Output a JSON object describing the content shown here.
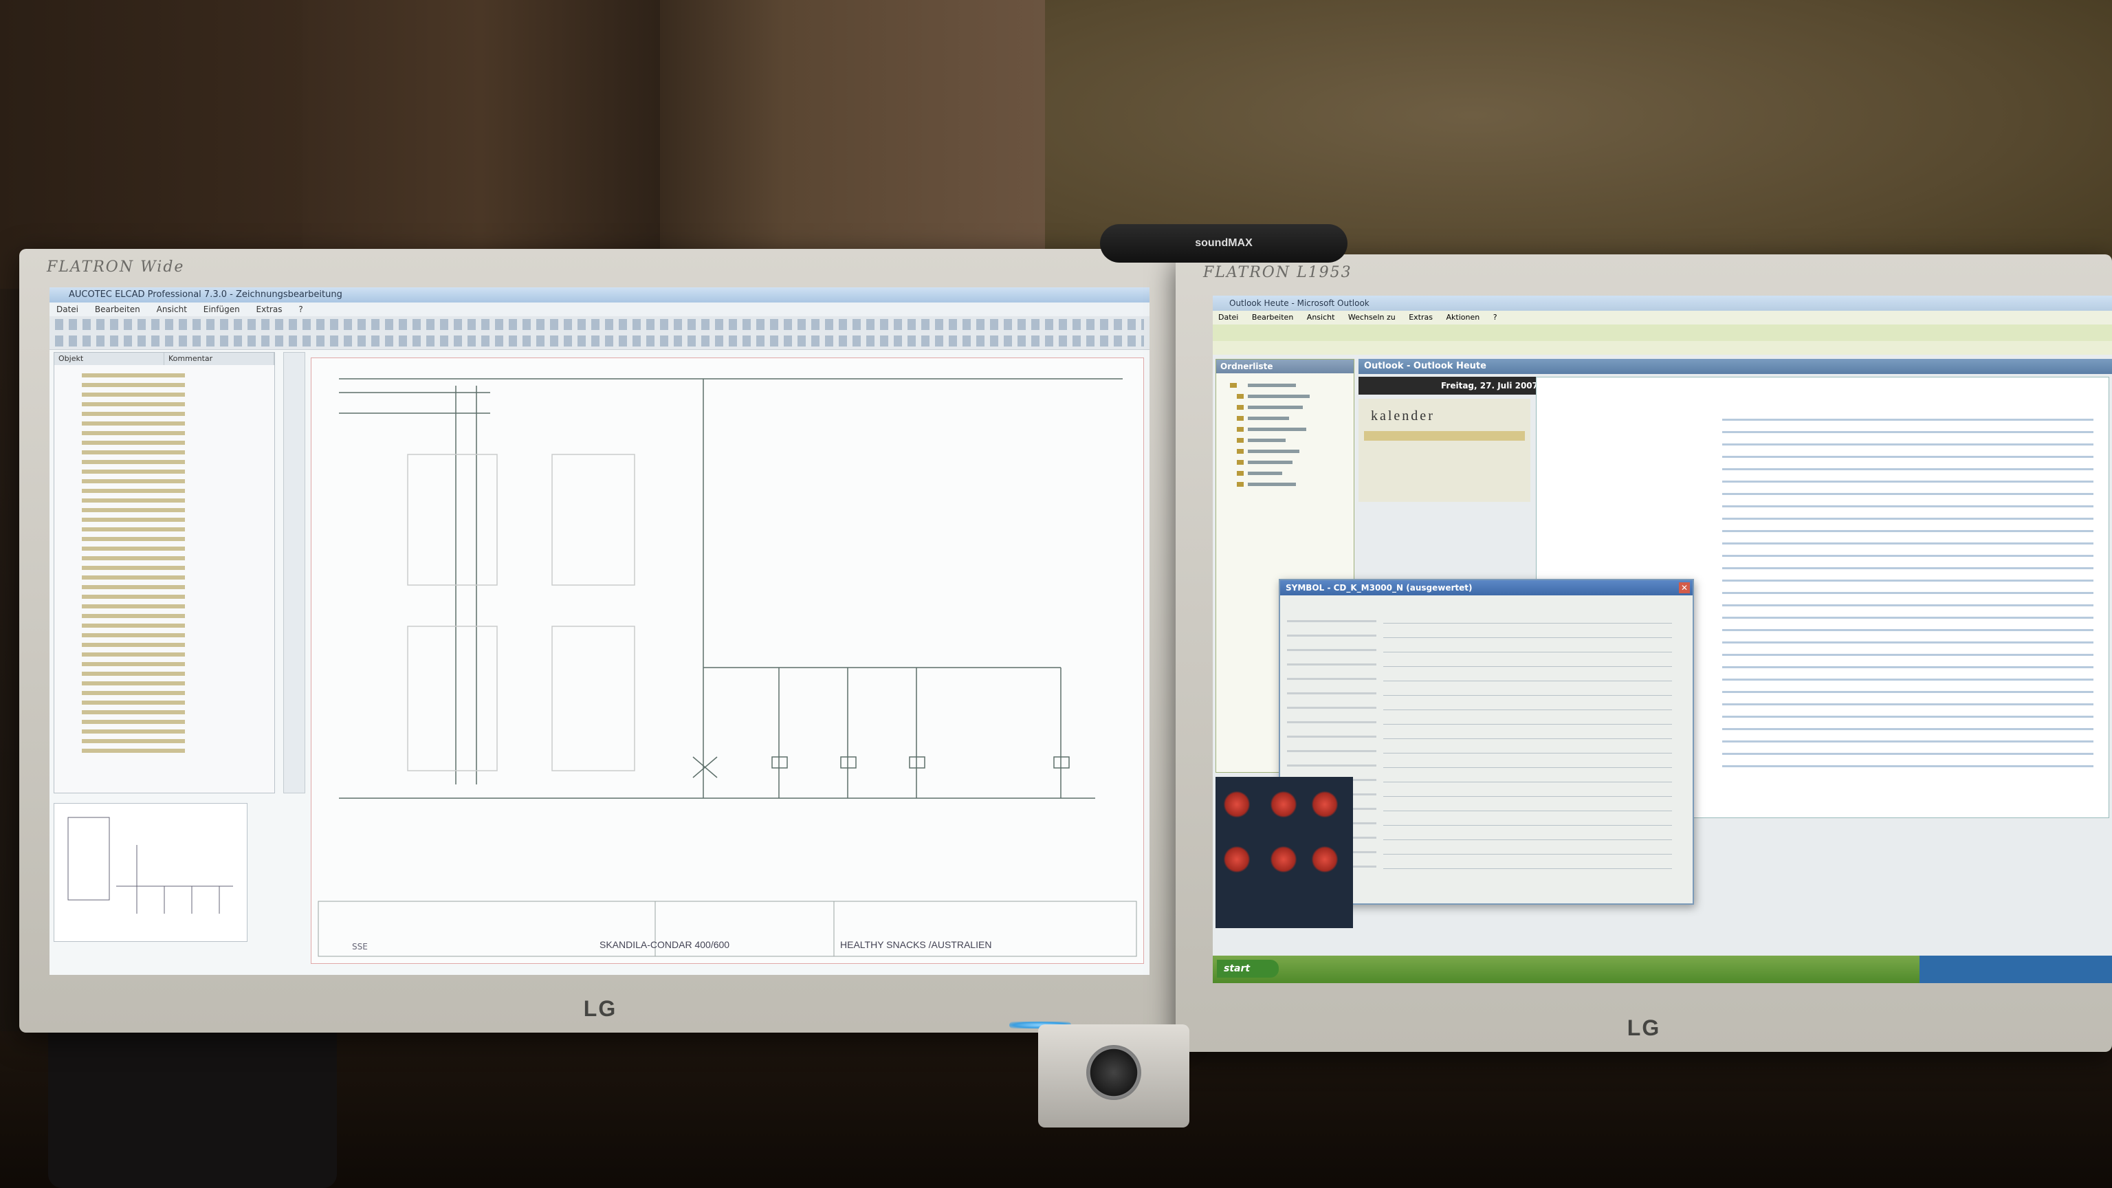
{
  "left_monitor": {
    "bezel_brand": "FLATRON Wide",
    "logo": "LG",
    "app": {
      "title": "AUCOTEC ELCAD Professional 7.3.0 - Zeichnungsbearbeitung",
      "menu": [
        "Datei",
        "Bearbeiten",
        "Ansicht",
        "Einfügen",
        "Extras",
        "?"
      ],
      "tree_columns": [
        "Objekt",
        "Kommentar"
      ],
      "sheet_code": "SSE",
      "sheet_title": "SKANDILA-CONDAR 400/600",
      "sheet_project": "HEALTHY SNACKS /AUSTRALIEN"
    }
  },
  "right_monitor": {
    "bezel_brand": "FLATRON L1953",
    "logo": "LG",
    "webcam_label": "soundMAX",
    "outlook": {
      "title": "Outlook Heute - Microsoft Outlook",
      "menu": [
        "Datei",
        "Bearbeiten",
        "Ansicht",
        "Wechseln zu",
        "Extras",
        "Aktionen",
        "?"
      ],
      "folder_pane_title": "Ordnerliste",
      "today_header": "Outlook - Outlook Heute",
      "date": "Freitag, 27. Juli 2007",
      "calendar_label": "kalender",
      "dialog_title": "SYMBOL - CD_K_M3000_N (ausgewertet)",
      "start_button": "start"
    }
  }
}
